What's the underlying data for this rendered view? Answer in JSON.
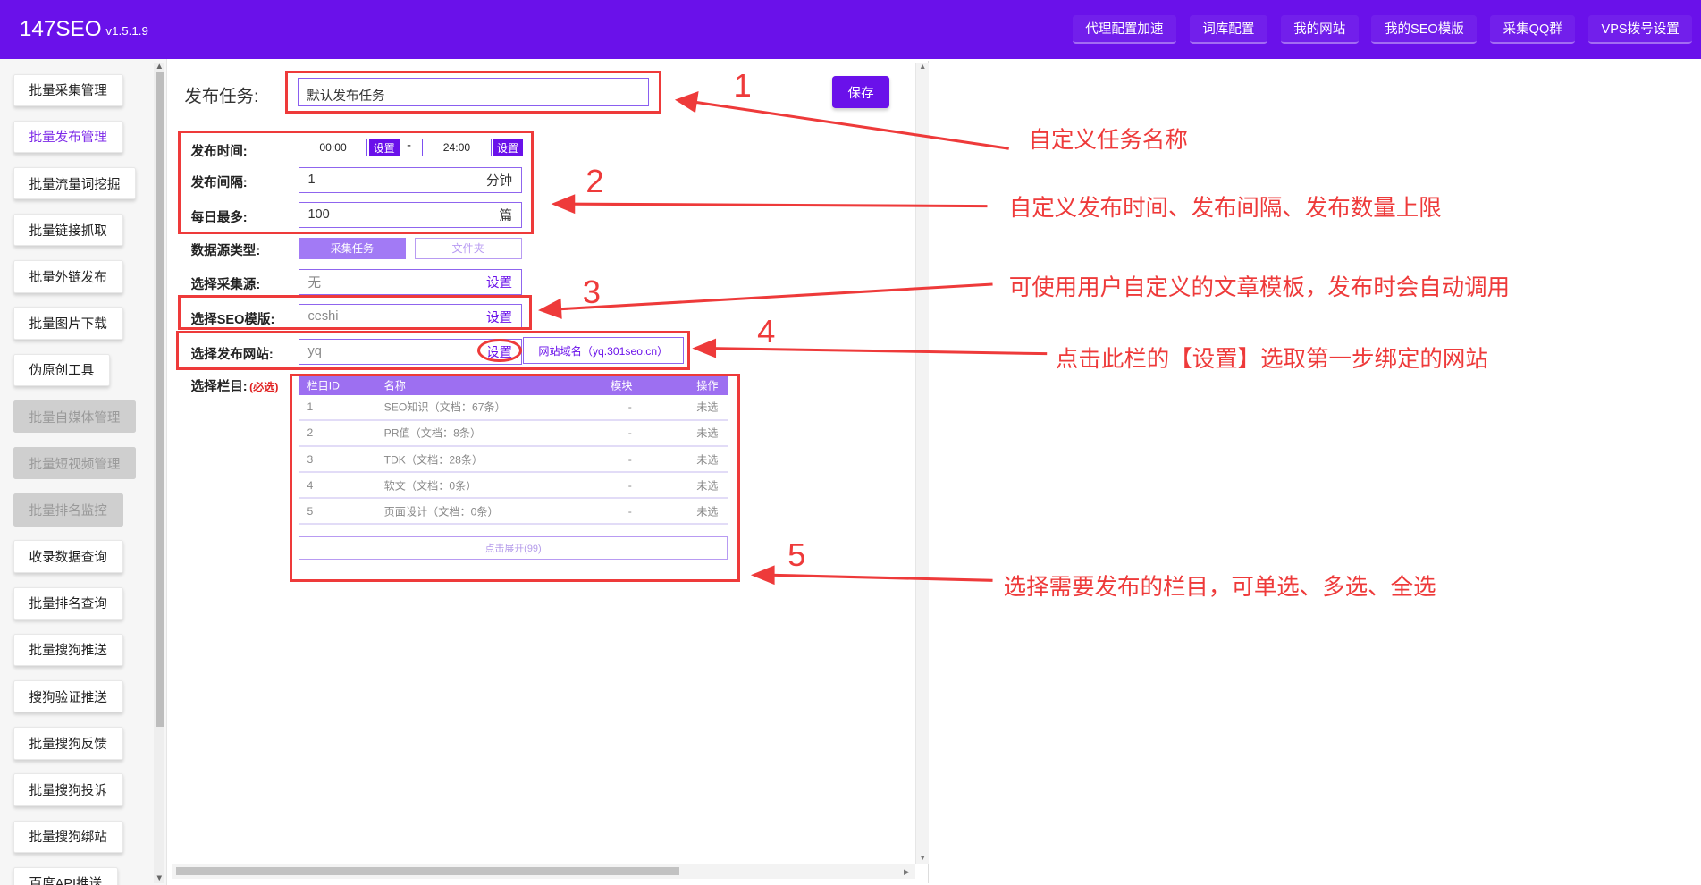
{
  "header": {
    "brand": "147SEO",
    "version": "v1.5.1.9",
    "nav": [
      "代理配置加速",
      "词库配置",
      "我的网站",
      "我的SEO模版",
      "采集QQ群",
      "VPS拨号设置"
    ]
  },
  "sidebar": {
    "items": [
      {
        "label": "批量采集管理",
        "state": "normal"
      },
      {
        "label": "批量发布管理",
        "state": "active"
      },
      {
        "label": "批量流量词挖掘",
        "state": "normal"
      },
      {
        "label": "批量链接抓取",
        "state": "normal"
      },
      {
        "label": "批量外链发布",
        "state": "normal"
      },
      {
        "label": "批量图片下载",
        "state": "normal"
      },
      {
        "label": "伪原创工具",
        "state": "normal"
      },
      {
        "label": "批量自媒体管理",
        "state": "disabled"
      },
      {
        "label": "批量短视频管理",
        "state": "disabled"
      },
      {
        "label": "批量排名监控",
        "state": "disabled"
      },
      {
        "label": "收录数据查询",
        "state": "normal"
      },
      {
        "label": "批量排名查询",
        "state": "normal"
      },
      {
        "label": "批量搜狗推送",
        "state": "normal"
      },
      {
        "label": "搜狗验证推送",
        "state": "normal"
      },
      {
        "label": "批量搜狗反馈",
        "state": "normal"
      },
      {
        "label": "批量搜狗投诉",
        "state": "normal"
      },
      {
        "label": "批量搜狗绑站",
        "state": "normal"
      },
      {
        "label": "百度API推送",
        "state": "normal"
      }
    ]
  },
  "form": {
    "task_label": "发布任务:",
    "task_value": "默认发布任务",
    "save_label": "保存",
    "time_label": "发布时间:",
    "time_start": "00:00",
    "time_end": "24:00",
    "time_sep": "-",
    "set_label": "设置",
    "interval_label": "发布间隔:",
    "interval_value": "1",
    "interval_unit": "分钟",
    "daily_label": "每日最多:",
    "daily_value": "100",
    "daily_unit": "篇",
    "datasource_label": "数据源类型:",
    "datasource_on": "采集任务",
    "datasource_off": "文件夹",
    "source_label": "选择采集源:",
    "source_value": "无",
    "seo_label": "选择SEO模版:",
    "seo_value": "ceshi",
    "site_label": "选择发布网站:",
    "site_value": "yq",
    "site_domain": "网站域名（yq.301seo.cn）",
    "column_label": "选择栏目:",
    "column_required": "(必选)"
  },
  "table": {
    "headers": [
      "栏目ID",
      "名称",
      "模块",
      "操作"
    ],
    "rows": [
      [
        "1",
        "SEO知识（文档：67条）",
        "-",
        "未选"
      ],
      [
        "2",
        "PR值（文档：8条）",
        "-",
        "未选"
      ],
      [
        "3",
        "TDK（文档：28条）",
        "-",
        "未选"
      ],
      [
        "4",
        "软文（文档：0条）",
        "-",
        "未选"
      ],
      [
        "5",
        "页面设计（文档：0条）",
        "-",
        "未选"
      ]
    ],
    "expand": "点击展开(99)"
  },
  "annotations": {
    "numbers": [
      "1",
      "2",
      "3",
      "4",
      "5"
    ],
    "notes": [
      "自定义任务名称",
      "自定义发布时间、发布间隔、发布数量上限",
      "可使用用户自定义的文章模板，发布时会自动调用",
      "点击此栏的【设置】选取第一步绑定的网站",
      "选择需要发布的栏目，可单选、多选、全选"
    ],
    "color": "#ee3a3a"
  },
  "colors": {
    "brand": "#6a11ea",
    "accent": "#9d6ff1"
  }
}
